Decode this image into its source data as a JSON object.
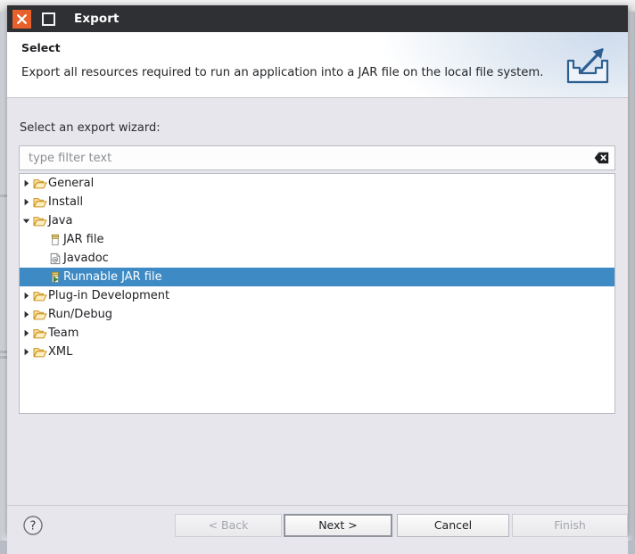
{
  "window": {
    "title": "Export",
    "close_icon": "close-icon",
    "maximize_icon": "maximize-icon"
  },
  "header": {
    "title": "Select",
    "description": "Export all resources required to run an application into a JAR file on the local file system.",
    "icon": "export-wizard-icon"
  },
  "body": {
    "wizard_label": "Select an export wizard:",
    "filter": {
      "value": "",
      "placeholder": "type filter text",
      "clear_icon": "clear-icon"
    },
    "tree": [
      {
        "label": "General",
        "icon": "folder-icon",
        "level": 0,
        "expanded": false,
        "selected": false
      },
      {
        "label": "Install",
        "icon": "folder-icon",
        "level": 0,
        "expanded": false,
        "selected": false
      },
      {
        "label": "Java",
        "icon": "folder-icon",
        "level": 0,
        "expanded": true,
        "selected": false
      },
      {
        "label": "JAR file",
        "icon": "jar-file-icon",
        "level": 1,
        "expanded": null,
        "selected": false
      },
      {
        "label": "Javadoc",
        "icon": "javadoc-icon",
        "level": 1,
        "expanded": null,
        "selected": false
      },
      {
        "label": "Runnable JAR file",
        "icon": "runnable-jar-icon",
        "level": 1,
        "expanded": null,
        "selected": true
      },
      {
        "label": "Plug-in Development",
        "icon": "folder-icon",
        "level": 0,
        "expanded": false,
        "selected": false
      },
      {
        "label": "Run/Debug",
        "icon": "folder-icon",
        "level": 0,
        "expanded": false,
        "selected": false
      },
      {
        "label": "Team",
        "icon": "folder-icon",
        "level": 0,
        "expanded": false,
        "selected": false
      },
      {
        "label": "XML",
        "icon": "folder-icon",
        "level": 0,
        "expanded": false,
        "selected": false
      }
    ]
  },
  "footer": {
    "help_icon": "help-icon",
    "buttons": [
      {
        "id": "back",
        "label": "< Back",
        "enabled": false,
        "default": false
      },
      {
        "id": "next",
        "label": "Next >",
        "enabled": true,
        "default": true
      },
      {
        "id": "cancel",
        "label": "Cancel",
        "enabled": true,
        "default": false
      },
      {
        "id": "finish",
        "label": "Finish",
        "enabled": false,
        "default": false
      }
    ]
  },
  "colors": {
    "titlebar_bg": "#2e3033",
    "close_button": "#e8612c",
    "selection": "#3d8ac4",
    "dialog_bg": "#e6e6ec",
    "folder": "#f0b429"
  }
}
